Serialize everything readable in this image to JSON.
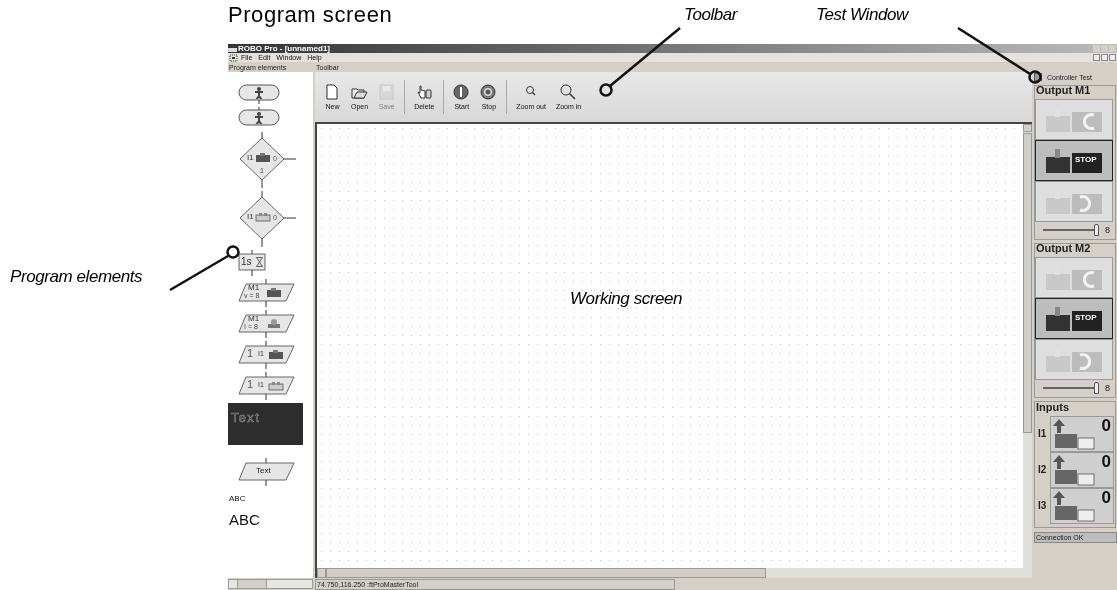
{
  "heading": "Program screen",
  "callouts": [
    {
      "kind": "left",
      "text": "Program elements"
    },
    {
      "kind": "toolbar",
      "text": "Toolbar"
    },
    {
      "kind": "testwindow",
      "text": "Test Window"
    },
    {
      "kind": "center",
      "text": "Working screen"
    }
  ],
  "window": {
    "title": "ROBO Pro - [unnamed1]"
  },
  "menu": [
    "File",
    "Edit",
    "Window",
    "Help"
  ],
  "elements_panel": {
    "title": "Program elements",
    "items": [
      {
        "kind": "start"
      },
      {
        "kind": "end"
      },
      {
        "kind": "branchmotor",
        "label": "I1",
        "out0": "0",
        "out1": "1"
      },
      {
        "kind": "branchswitch",
        "label": "I1",
        "out0": "0"
      },
      {
        "kind": "wait",
        "label": "1s"
      },
      {
        "kind": "motoroutput",
        "label": "M1",
        "sub": "v = 8"
      },
      {
        "kind": "lampoutput",
        "label": "M1",
        "sub": "I = 8"
      },
      {
        "kind": "motorio",
        "value": "1",
        "port": "I1"
      },
      {
        "kind": "switchio",
        "value": "1",
        "port": "I1"
      },
      {
        "kind": "comment",
        "label": "Text"
      },
      {
        "kind": "textout",
        "label": "Text"
      },
      {
        "kind": "small",
        "label": "ABC"
      },
      {
        "kind": "large",
        "label": "ABC"
      }
    ]
  },
  "toolbar": {
    "title": "Toolbar",
    "buttons": [
      {
        "kind": "new",
        "label": "New",
        "disabled": false
      },
      {
        "kind": "open",
        "label": "Open",
        "disabled": false
      },
      {
        "kind": "save",
        "label": "Save",
        "disabled": true
      },
      {
        "kind": "delete",
        "label": "Delete",
        "disabled": false
      },
      {
        "kind": "start",
        "label": "Start",
        "disabled": false
      },
      {
        "kind": "stop",
        "label": "Stop",
        "disabled": false
      },
      {
        "kind": "zoomout",
        "label": "Zoom out",
        "disabled": false
      },
      {
        "kind": "zoomin",
        "label": "Zoom in",
        "disabled": false
      }
    ]
  },
  "status_bar": {
    "text": "74.750,116.250 :ftProMasterTool"
  },
  "test_window": {
    "title": "Controller Test",
    "outputs": [
      {
        "title": "Output M1",
        "buttons": [
          {
            "kind": "left",
            "selected": false
          },
          {
            "kind": "stop",
            "label": "STOP",
            "selected": true
          },
          {
            "kind": "right",
            "selected": false
          }
        ],
        "level": 1,
        "reading": "8"
      },
      {
        "title": "Output M2",
        "buttons": [
          {
            "kind": "left",
            "selected": false
          },
          {
            "kind": "stop",
            "label": "STOP",
            "selected": true
          },
          {
            "kind": "right",
            "selected": false
          }
        ],
        "level": 1,
        "reading": "8"
      }
    ],
    "inputs": {
      "title": "Inputs",
      "items": [
        {
          "label": "I1",
          "value": "0"
        },
        {
          "label": "I2",
          "value": "0"
        },
        {
          "label": "I3",
          "value": "0"
        }
      ]
    },
    "status": "Connection OK"
  }
}
